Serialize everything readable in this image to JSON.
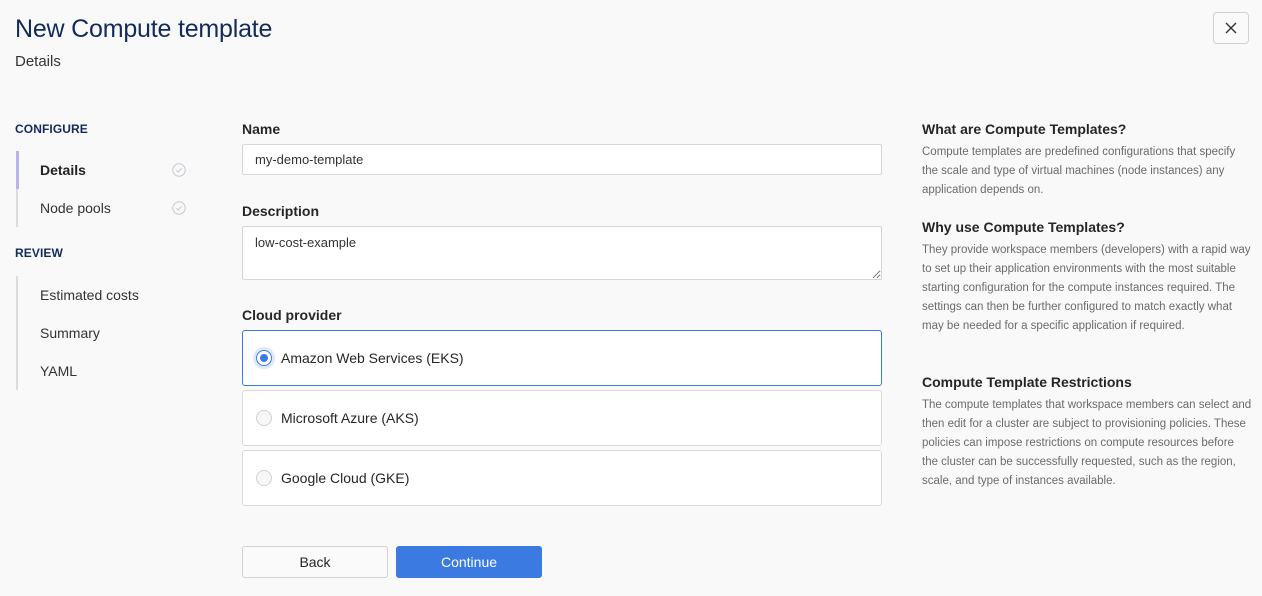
{
  "header": {
    "title": "New Compute template",
    "subtitle": "Details",
    "close_icon": "close-icon"
  },
  "sidebar": {
    "sections": [
      {
        "label": "CONFIGURE",
        "items": [
          {
            "label": "Details",
            "active": true,
            "completed_icon": "check-circle-icon"
          },
          {
            "label": "Node pools",
            "active": false,
            "completed_icon": "check-circle-icon"
          }
        ]
      },
      {
        "label": "REVIEW",
        "items": [
          {
            "label": "Estimated costs"
          },
          {
            "label": "Summary"
          },
          {
            "label": "YAML"
          }
        ]
      }
    ]
  },
  "form": {
    "name": {
      "label": "Name",
      "value": "my-demo-template"
    },
    "description": {
      "label": "Description",
      "value": "low-cost-example"
    },
    "cloud_provider": {
      "label": "Cloud provider",
      "selected": "Amazon Web Services (EKS)",
      "options": [
        {
          "label": "Amazon Web Services (EKS)",
          "checked": true
        },
        {
          "label": "Microsoft Azure (AKS)",
          "checked": false
        },
        {
          "label": "Google Cloud (GKE)",
          "checked": false
        }
      ]
    },
    "buttons": {
      "back": "Back",
      "continue": "Continue"
    }
  },
  "help": [
    {
      "heading": "What are Compute Templates?",
      "body": "Compute templates are predefined configurations that specify the scale and type of virtual machines (node instances) any application depends on."
    },
    {
      "heading": "Why use Compute Templates?",
      "body": "They provide workspace members (developers) with a rapid way to set up their application environments with the most suitable starting configuration for the compute instances required. The settings can then be further configured to match exactly what may be needed for a specific application if required."
    },
    {
      "heading": "Compute Template Restrictions",
      "body": "The compute templates that workspace members can select and then edit for a cluster are subject to provisioning policies. These policies can impose restrictions on compute resources before the cluster can be successfully requested, such as the region, scale, and type of instances available."
    }
  ],
  "colors": {
    "title": "#132b5c",
    "accent": "#3b7ae0",
    "active_rail": "#b8b4ee"
  }
}
